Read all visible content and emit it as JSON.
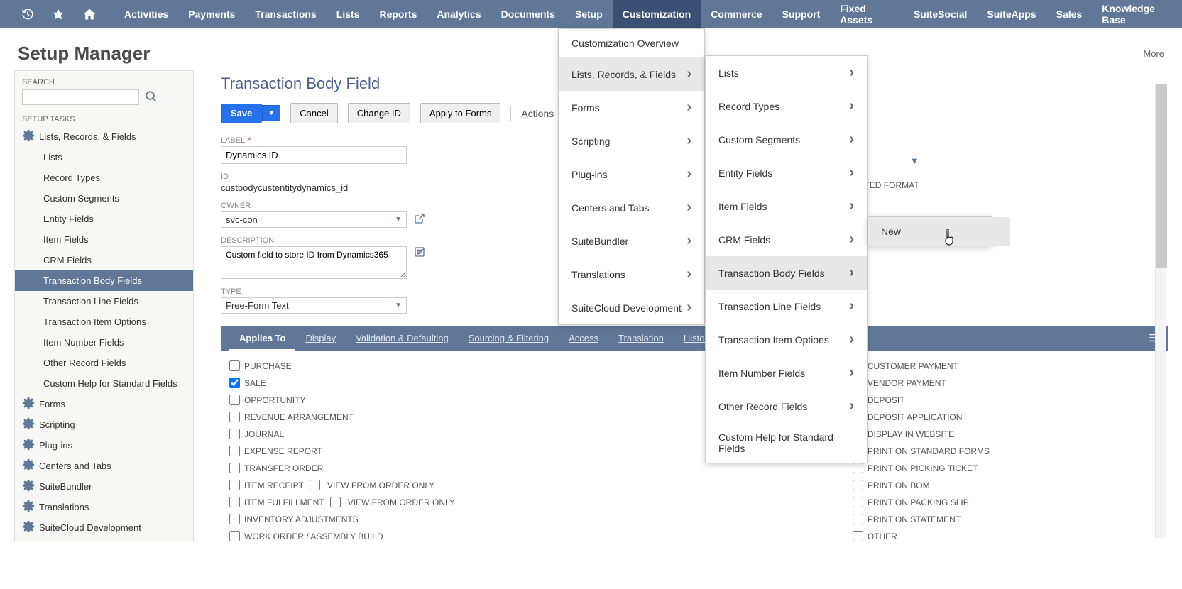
{
  "topnav": {
    "items": [
      "Activities",
      "Payments",
      "Transactions",
      "Lists",
      "Reports",
      "Analytics",
      "Documents",
      "Setup",
      "Customization",
      "Commerce",
      "Support",
      "Fixed Assets",
      "SuiteSocial",
      "SuiteApps",
      "Sales",
      "Knowledge Base"
    ]
  },
  "pageHeader": {
    "title": "Setup Manager",
    "more": "More"
  },
  "sidebar": {
    "searchLabel": "SEARCH",
    "tasksLabel": "SETUP TASKS",
    "parent": "Lists, Records, & Fields",
    "children": [
      "Lists",
      "Record Types",
      "Custom Segments",
      "Entity Fields",
      "Item Fields",
      "CRM Fields",
      "Transaction Body Fields",
      "Transaction Line Fields",
      "Transaction Item Options",
      "Item Number Fields",
      "Other Record Fields",
      "Custom Help for Standard Fields"
    ],
    "others": [
      "Forms",
      "Scripting",
      "Plug-ins",
      "Centers and Tabs",
      "SuiteBundler",
      "Translations",
      "SuiteCloud Development"
    ]
  },
  "content": {
    "title": "Transaction Body Field",
    "buttons": {
      "save": "Save",
      "cancel": "Cancel",
      "changeId": "Change ID",
      "applyForms": "Apply to Forms",
      "actions": "Actions"
    },
    "form": {
      "labelLabel": "LABEL",
      "labelVal": "Dynamics ID",
      "idLabel": "ID",
      "idVal": "custbodycustentitydynamics_id",
      "ownerLabel": "OWNER",
      "ownerVal": "svc-con",
      "descLabel": "DESCRIPTION",
      "descVal": "Custom field to store ID from Dynamics365",
      "typeLabel": "TYPE",
      "typeVal": "Free-Form Text"
    },
    "rightCol": {
      "encrypted": "RYPTED FORMAT"
    },
    "tabs": [
      "Applies To",
      "Display",
      "Validation & Defaulting",
      "Sourcing & Filtering",
      "Access",
      "Translation",
      "History"
    ],
    "checksLeft": [
      {
        "label": "PURCHASE",
        "checked": false
      },
      {
        "label": "SALE",
        "checked": true
      },
      {
        "label": "OPPORTUNITY",
        "checked": false
      },
      {
        "label": "REVENUE ARRANGEMENT",
        "checked": false
      },
      {
        "label": "JOURNAL",
        "checked": false
      },
      {
        "label": "EXPENSE REPORT",
        "checked": false
      },
      {
        "label": "TRANSFER ORDER",
        "checked": false
      },
      {
        "label": "ITEM RECEIPT",
        "checked": false,
        "inline": "VIEW FROM ORDER ONLY"
      },
      {
        "label": "ITEM FULFILLMENT",
        "checked": false,
        "inline": "VIEW FROM ORDER ONLY"
      },
      {
        "label": "INVENTORY ADJUSTMENTS",
        "checked": false
      },
      {
        "label": "WORK ORDER / ASSEMBLY BUILD",
        "checked": false
      }
    ],
    "checksRight": [
      {
        "label": "CUSTOMER PAYMENT",
        "checked": false
      },
      {
        "label": "VENDOR PAYMENT",
        "checked": false
      },
      {
        "label": "DEPOSIT",
        "checked": false
      },
      {
        "label": "DEPOSIT APPLICATION",
        "checked": false
      },
      {
        "label": "DISPLAY IN WEBSITE",
        "checked": false
      },
      {
        "label": "PRINT ON STANDARD FORMS",
        "checked": false
      },
      {
        "label": "PRINT ON PICKING TICKET",
        "checked": false
      },
      {
        "label": "PRINT ON BOM",
        "checked": false
      },
      {
        "label": "PRINT ON PACKING SLIP",
        "checked": false
      },
      {
        "label": "PRINT ON STATEMENT",
        "checked": false
      },
      {
        "label": "OTHER",
        "checked": false
      }
    ]
  },
  "menu1": {
    "items": [
      {
        "label": "Customization Overview",
        "sub": false
      },
      {
        "label": "Lists, Records, & Fields",
        "sub": true,
        "hover": true
      },
      {
        "label": "Forms",
        "sub": true
      },
      {
        "label": "Scripting",
        "sub": true
      },
      {
        "label": "Plug-ins",
        "sub": true
      },
      {
        "label": "Centers and Tabs",
        "sub": true
      },
      {
        "label": "SuiteBundler",
        "sub": true
      },
      {
        "label": "Translations",
        "sub": true
      },
      {
        "label": "SuiteCloud Development",
        "sub": true
      }
    ]
  },
  "menu2": {
    "items": [
      {
        "label": "Lists",
        "sub": true
      },
      {
        "label": "Record Types",
        "sub": true
      },
      {
        "label": "Custom Segments",
        "sub": true
      },
      {
        "label": "Entity Fields",
        "sub": true
      },
      {
        "label": "Item Fields",
        "sub": true
      },
      {
        "label": "CRM Fields",
        "sub": true
      },
      {
        "label": "Transaction Body Fields",
        "sub": true,
        "hover": true
      },
      {
        "label": "Transaction Line Fields",
        "sub": true
      },
      {
        "label": "Transaction Item Options",
        "sub": true
      },
      {
        "label": "Item Number Fields",
        "sub": true
      },
      {
        "label": "Other Record Fields",
        "sub": true
      },
      {
        "label": "Custom Help for Standard Fields",
        "sub": false
      }
    ]
  },
  "menu3": {
    "items": [
      {
        "label": "New",
        "hover": true
      }
    ]
  }
}
